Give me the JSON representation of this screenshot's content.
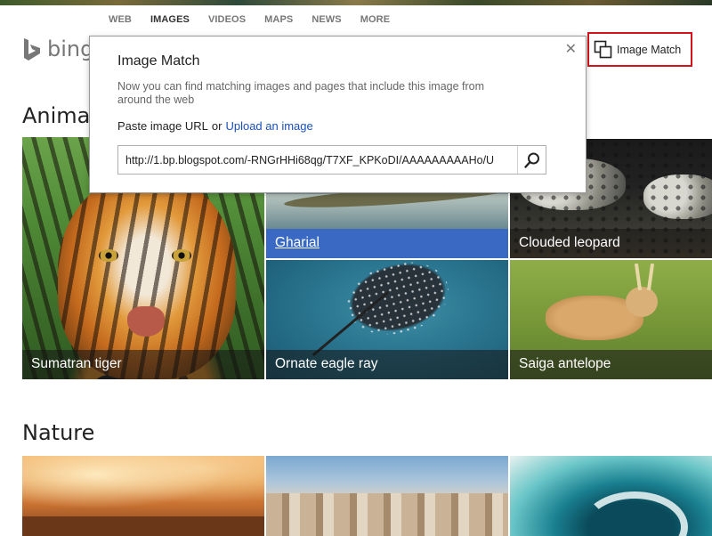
{
  "nav": {
    "items": [
      "WEB",
      "IMAGES",
      "VIDEOS",
      "MAPS",
      "NEWS",
      "MORE"
    ],
    "active": "IMAGES"
  },
  "logo": {
    "text": "bing"
  },
  "image_match_button": {
    "label": "Image Match",
    "icon": "image-match-icon",
    "highlight_color": "#d4141a"
  },
  "popup": {
    "title": "Image Match",
    "description": "Now you can find matching images and pages that include this image from around the web",
    "paste_label": "Paste image URL",
    "or_text": "or",
    "upload_link": "Upload an image",
    "url_value": "http://1.bp.blogspot.com/-RNGrHHi68qg/T7XF_KPKoDI/AAAAAAAAAHo/U",
    "close_icon": "close-icon",
    "search_icon": "search-icon"
  },
  "sections": {
    "animals": {
      "title": "Animal",
      "tiles": {
        "tiger": "Sumatran tiger",
        "gharial": "Gharial",
        "leopard": "Clouded leopard",
        "ray": "Ornate eagle ray",
        "saiga": "Saiga antelope"
      }
    },
    "nature": {
      "title": "Nature"
    }
  },
  "colors": {
    "link": "#1a50b8",
    "selected_caption": "#3a69c4"
  }
}
